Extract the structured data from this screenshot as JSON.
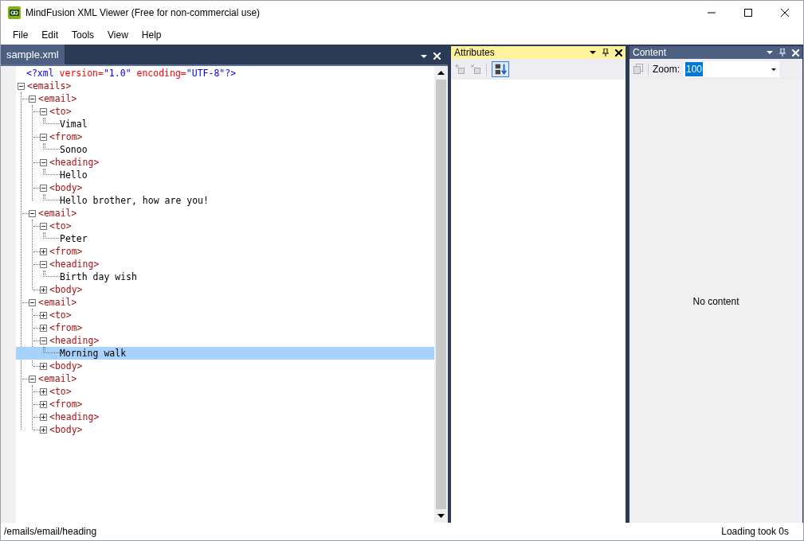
{
  "window": {
    "title": "MindFusion XML Viewer (Free for non-commercial use)"
  },
  "menu": [
    "File",
    "Edit",
    "Tools",
    "View",
    "Help"
  ],
  "document": {
    "tab": {
      "label": "sample.xml",
      "selected": true
    },
    "declaration": [
      {
        "kind": "punct",
        "text": "<?xml"
      },
      {
        "kind": "attr",
        "text": " version="
      },
      {
        "kind": "value",
        "text": "\"1.0\""
      },
      {
        "kind": "attr",
        "text": " encoding="
      },
      {
        "kind": "value",
        "text": "\"UTF-8\""
      },
      {
        "kind": "punct",
        "text": "?>"
      }
    ],
    "tree": [
      {
        "kind": "element",
        "label": "<emails>",
        "expanded": true,
        "selected": false,
        "children": [
          {
            "kind": "element",
            "label": "<email>",
            "expanded": true,
            "selected": false,
            "children": [
              {
                "kind": "element",
                "label": "<to>",
                "expanded": true,
                "selected": false,
                "children": [
                  {
                    "kind": "text",
                    "label": "Vimal",
                    "selected": false
                  }
                ]
              },
              {
                "kind": "element",
                "label": "<from>",
                "expanded": true,
                "selected": false,
                "children": [
                  {
                    "kind": "text",
                    "label": "Sonoo",
                    "selected": false
                  }
                ]
              },
              {
                "kind": "element",
                "label": "<heading>",
                "expanded": true,
                "selected": false,
                "children": [
                  {
                    "kind": "text",
                    "label": "Hello",
                    "selected": false
                  }
                ]
              },
              {
                "kind": "element",
                "label": "<body>",
                "expanded": true,
                "selected": false,
                "children": [
                  {
                    "kind": "text",
                    "label": "Hello brother, how are you!",
                    "selected": false
                  }
                ]
              }
            ]
          },
          {
            "kind": "element",
            "label": "<email>",
            "expanded": true,
            "selected": false,
            "children": [
              {
                "kind": "element",
                "label": "<to>",
                "expanded": true,
                "selected": false,
                "children": [
                  {
                    "kind": "text",
                    "label": "Peter",
                    "selected": false
                  }
                ]
              },
              {
                "kind": "element",
                "label": "<from>",
                "expanded": false,
                "selected": false
              },
              {
                "kind": "element",
                "label": "<heading>",
                "expanded": true,
                "selected": false,
                "children": [
                  {
                    "kind": "text",
                    "label": "Birth day wish",
                    "selected": false
                  }
                ]
              },
              {
                "kind": "element",
                "label": "<body>",
                "expanded": false,
                "selected": false
              }
            ]
          },
          {
            "kind": "element",
            "label": "<email>",
            "expanded": true,
            "selected": false,
            "children": [
              {
                "kind": "element",
                "label": "<to>",
                "expanded": false,
                "selected": false
              },
              {
                "kind": "element",
                "label": "<from>",
                "expanded": false,
                "selected": false
              },
              {
                "kind": "element",
                "label": "<heading>",
                "expanded": true,
                "selected": false,
                "children": [
                  {
                    "kind": "text",
                    "label": "Morning walk",
                    "selected": true
                  }
                ]
              },
              {
                "kind": "element",
                "label": "<body>",
                "expanded": false,
                "selected": false
              }
            ]
          },
          {
            "kind": "element",
            "label": "<email>",
            "expanded": true,
            "selected": false,
            "children": [
              {
                "kind": "element",
                "label": "<to>",
                "expanded": false,
                "selected": false
              },
              {
                "kind": "element",
                "label": "<from>",
                "expanded": false,
                "selected": false
              },
              {
                "kind": "element",
                "label": "<heading>",
                "expanded": false,
                "selected": false
              },
              {
                "kind": "element",
                "label": "<body>",
                "expanded": false,
                "selected": false
              }
            ]
          }
        ]
      }
    ]
  },
  "attributes": {
    "title": "Attributes"
  },
  "content": {
    "title": "Content",
    "zoom_label": "Zoom:",
    "zoom_value": "100",
    "message": "No content"
  },
  "status_bar": {
    "path": "/emails/email/heading",
    "info": "Loading took 0s"
  }
}
